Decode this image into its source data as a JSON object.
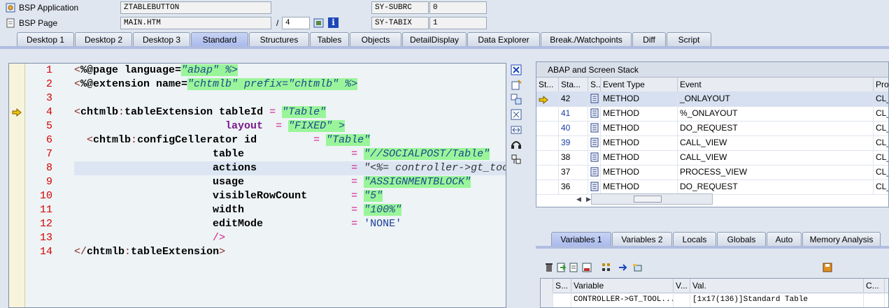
{
  "header": {
    "bsp_app_label": "BSP Application",
    "bsp_app_value": "ZTABLEBUTTON",
    "bsp_page_label": "BSP Page",
    "bsp_page_value": "MAIN.HTM",
    "page_sep": "/",
    "page_count": "4",
    "info_glyph": "i",
    "subrc_label": "SY-SUBRC",
    "subrc_value": "0",
    "tabix_label": "SY-TABIX",
    "tabix_value": "1"
  },
  "tabs": [
    "Desktop 1",
    "Desktop 2",
    "Desktop 3",
    "Standard",
    "Structures",
    "Tables",
    "Objects",
    "DetailDisplay",
    "Data Explorer",
    "Break./Watchpoints",
    "Diff",
    "Script"
  ],
  "active_tab": "Standard",
  "code": {
    "current_line": 4,
    "highlight_line": 8,
    "lines": [
      {
        "n": "1",
        "tokens": [
          [
            "br",
            "<"
          ],
          [
            "attr",
            "%@page language="
          ],
          [
            "str",
            "\"abap\" %>"
          ]
        ]
      },
      {
        "n": "2",
        "tokens": [
          [
            "br",
            "<"
          ],
          [
            "attr",
            "%@extension name="
          ],
          [
            "str",
            "\"chtmlb\" prefix=\"chtmlb\" %>"
          ]
        ]
      },
      {
        "n": "3",
        "tokens": []
      },
      {
        "n": "4",
        "tokens": [
          [
            "br",
            "<"
          ],
          [
            "tag",
            "chtmlb"
          ],
          [
            "ns",
            ":"
          ],
          [
            "tag",
            "tableExtension tableId "
          ],
          [
            "eq",
            "= "
          ],
          [
            "str",
            "\"Table\""
          ]
        ]
      },
      {
        "n": "5",
        "tokens": [
          [
            "sp",
            "                        "
          ],
          [
            "attr2",
            "layout  "
          ],
          [
            "eq",
            "= "
          ],
          [
            "str",
            "\"FIXED\" >"
          ]
        ]
      },
      {
        "n": "6",
        "tokens": [
          [
            "sp",
            "  "
          ],
          [
            "br",
            "<"
          ],
          [
            "tag",
            "chtmlb"
          ],
          [
            "ns",
            ":"
          ],
          [
            "tag",
            "configCellerator id         "
          ],
          [
            "eq",
            "= "
          ],
          [
            "str",
            "\"Table\""
          ]
        ]
      },
      {
        "n": "7",
        "tokens": [
          [
            "sp",
            "                      "
          ],
          [
            "attr",
            "table                 "
          ],
          [
            "eq",
            "= "
          ],
          [
            "str",
            "\"//SOCIALPOST/Table\""
          ]
        ]
      },
      {
        "n": "8",
        "tokens": [
          [
            "sp",
            "                      "
          ],
          [
            "attr",
            "actions               "
          ],
          [
            "eq",
            "= "
          ],
          [
            "dim",
            "\"<%= controller->gt_toolbar %>\""
          ]
        ]
      },
      {
        "n": "9",
        "tokens": [
          [
            "sp",
            "                      "
          ],
          [
            "attr",
            "usage                 "
          ],
          [
            "eq",
            "= "
          ],
          [
            "str",
            "\"ASSIGNMENTBLOCK\""
          ]
        ]
      },
      {
        "n": "10",
        "tokens": [
          [
            "sp",
            "                      "
          ],
          [
            "attr",
            "visibleRowCount       "
          ],
          [
            "eq",
            "= "
          ],
          [
            "str",
            "\"5\""
          ]
        ]
      },
      {
        "n": "11",
        "tokens": [
          [
            "sp",
            "                      "
          ],
          [
            "attr",
            "width                 "
          ],
          [
            "eq",
            "= "
          ],
          [
            "str",
            "\"100%\""
          ]
        ]
      },
      {
        "n": "12",
        "tokens": [
          [
            "sp",
            "                      "
          ],
          [
            "attr",
            "editMode              "
          ],
          [
            "eq",
            "= "
          ],
          [
            "plain",
            "'NONE'"
          ]
        ]
      },
      {
        "n": "13",
        "tokens": [
          [
            "sp",
            "                      "
          ],
          [
            "eq",
            "/>"
          ]
        ]
      },
      {
        "n": "14",
        "tokens": [
          [
            "br",
            "</"
          ],
          [
            "tag",
            "chtmlb"
          ],
          [
            "ns",
            ":"
          ],
          [
            "tag",
            "tableExtension"
          ],
          [
            "br",
            ">"
          ]
        ]
      }
    ]
  },
  "stack": {
    "title": "ABAP and Screen Stack",
    "columns": [
      "St...",
      "Sta...",
      "S...",
      "Event Type",
      "Event",
      "Prog"
    ],
    "rows": [
      {
        "level": "42",
        "type": "METHOD",
        "event": "_ONLAYOUT",
        "prog": "CL_C",
        "current": true,
        "link": false
      },
      {
        "level": "41",
        "type": "METHOD",
        "event": "%_ONLAYOUT",
        "prog": "CL_C",
        "current": false,
        "link": true
      },
      {
        "level": "40",
        "type": "METHOD",
        "event": "DO_REQUEST",
        "prog": "CL_B",
        "current": false,
        "link": true
      },
      {
        "level": "39",
        "type": "METHOD",
        "event": "CALL_VIEW",
        "prog": "CL_B",
        "current": false,
        "link": true
      },
      {
        "level": "38",
        "type": "METHOD",
        "event": "CALL_VIEW",
        "prog": "CL_B",
        "current": false,
        "link": false
      },
      {
        "level": "37",
        "type": "METHOD",
        "event": "PROCESS_VIEW",
        "prog": "CL_B",
        "current": false,
        "link": false
      },
      {
        "level": "36",
        "type": "METHOD",
        "event": "DO_REQUEST",
        "prog": "CL_B",
        "current": false,
        "link": false
      }
    ]
  },
  "vars": {
    "tabs": [
      "Variables 1",
      "Variables 2",
      "Locals",
      "Globals",
      "Auto",
      "Memory Analysis"
    ],
    "active_tab": "Variables 1",
    "columns": [
      "S...",
      "Variable",
      "V...",
      "Val.",
      "C..."
    ],
    "rows": [
      {
        "variable": "CONTROLLER->GT_TOOL...",
        "value": "[1x17(136)]Standard Table"
      }
    ]
  },
  "colors": {
    "accent": "#a8b9ec",
    "string_bg": "#9af59a",
    "line_number": "#d40000"
  }
}
